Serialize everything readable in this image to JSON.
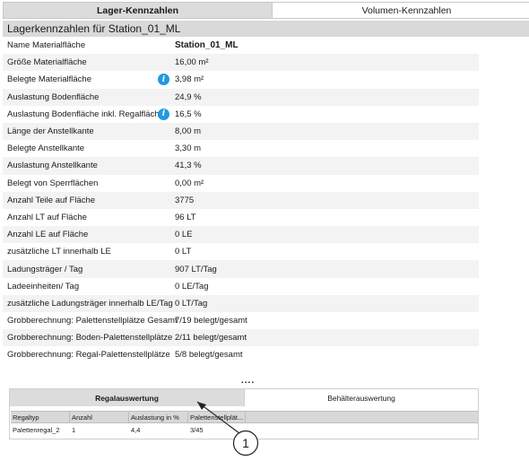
{
  "top_tabs": [
    {
      "label": "Lager-Kennzahlen",
      "active": true
    },
    {
      "label": "Volumen-Kennzahlen",
      "active": false
    }
  ],
  "section_title": "Lagerkennzahlen für Station_01_ML",
  "rows": [
    {
      "label": "Name Materialfläche",
      "value": "Station_01_ML"
    },
    {
      "label": "Größe Materialfläche",
      "value": "16,00 m²"
    },
    {
      "label": "Belegte Materialfläche",
      "value": "3,98 m²"
    },
    {
      "label": "Auslastung Bodenfläche",
      "value": "24,9 %"
    },
    {
      "label": "Auslastung Bodenfläche inkl. Regalfläche",
      "value": "16,5 %"
    },
    {
      "label": "Länge der Anstellkante",
      "value": "8,00 m"
    },
    {
      "label": "Belegte Anstellkante",
      "value": "3,30 m"
    },
    {
      "label": "Auslastung Anstellkante",
      "value": "41,3 %"
    },
    {
      "label": "Belegt von Sperrflächen",
      "value": "0,00 m²"
    },
    {
      "label": "Anzahl Teile auf Fläche",
      "value": "3775"
    },
    {
      "label": "Anzahl LT auf Fläche",
      "value": "96 LT"
    },
    {
      "label": "Anzahl LE auf Fläche",
      "value": "0 LE"
    },
    {
      "label": "zusätzliche LT innerhalb LE",
      "value": "0 LT"
    },
    {
      "label": "Ladungsträger / Tag",
      "value": "907 LT/Tag"
    },
    {
      "label": "Ladeeinheiten/ Tag",
      "value": "0 LE/Tag"
    },
    {
      "label": "zusätzliche Ladungsträger innerhalb LE/Tag",
      "value": "0 LT/Tag"
    },
    {
      "label": "Grobberechnung: Palettenstellplätze Gesamt",
      "value": "7/19 belegt/gesamt"
    },
    {
      "label": "Grobberechnung: Boden-Palettenstellplätze",
      "value": "2/11 belegt/gesamt"
    },
    {
      "label": "Grobberechnung: Regal-Palettenstellplätze",
      "value": "5/8 belegt/gesamt"
    }
  ],
  "ellipsis": "....",
  "bottom_tabs": [
    {
      "label": "Regalauswertung",
      "active": true
    },
    {
      "label": "Behälterauswertung",
      "active": false
    }
  ],
  "grid": {
    "columns": [
      "Regaltyp",
      "Anzahl",
      "Auslastung in %",
      "Palettenstellplät..."
    ],
    "rows": [
      [
        "Palettenregal_2",
        "1",
        "4,4",
        "3/45"
      ]
    ]
  },
  "callout": "1",
  "colors": {
    "info_icon": "#1e9ae0",
    "tab_active": "#dcdcdc"
  },
  "icons": {
    "info": "info-icon"
  }
}
